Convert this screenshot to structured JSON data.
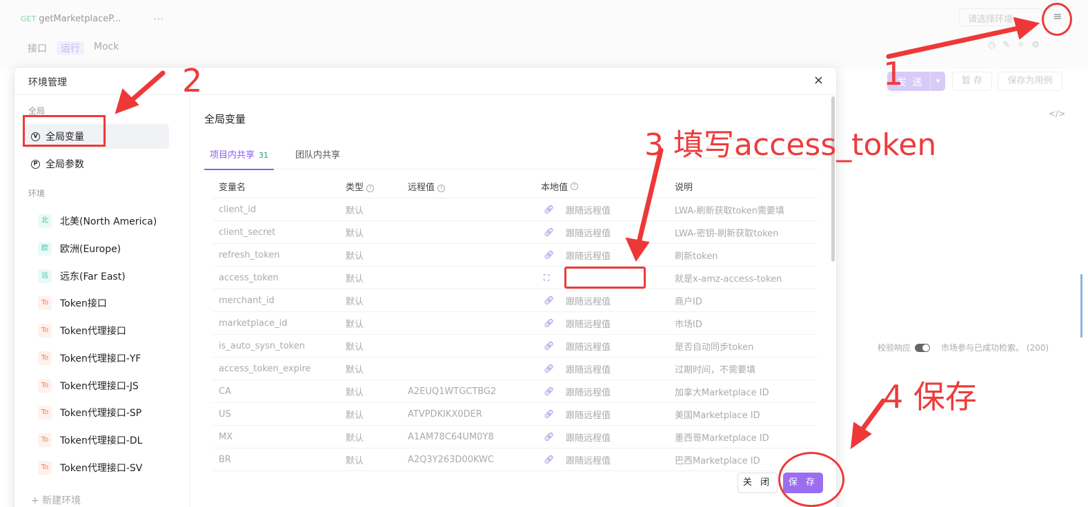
{
  "app": {
    "request_tab": {
      "method": "GET",
      "name": "getMarketplaceP..."
    },
    "more_dots": "···",
    "sub_tabs": [
      "接口",
      "运行",
      "Mock"
    ],
    "env_select": "请选择环境",
    "menu_icon": "≡",
    "send_label": "发 送",
    "save_tmp_label": "暂 存",
    "save_case_label": "保存为用例",
    "code_icon": "</>",
    "verify_label": "校验响应",
    "verify_msg": "市场参与已成功检索。 (200)"
  },
  "modal": {
    "title": "环境管理",
    "close_icon": "×",
    "sidebar": {
      "global_section": "全局",
      "global_items": [
        {
          "icon": "V",
          "label": "全局变量"
        },
        {
          "icon": "P",
          "label": "全局参数"
        }
      ],
      "env_section": "环境",
      "environments": [
        {
          "badge": "北",
          "label": "北美(North America)",
          "color": "teal"
        },
        {
          "badge": "欧",
          "label": "欧洲(Europe)",
          "color": "teal"
        },
        {
          "badge": "远",
          "label": "远东(Far East)",
          "color": "teal"
        },
        {
          "badge": "To",
          "label": "Token接口",
          "color": "orange"
        },
        {
          "badge": "To",
          "label": "Token代理接口",
          "color": "orange"
        },
        {
          "badge": "To",
          "label": "Token代理接口-YF",
          "color": "orange"
        },
        {
          "badge": "To",
          "label": "Token代理接口-JS",
          "color": "orange"
        },
        {
          "badge": "To",
          "label": "Token代理接口-SP",
          "color": "orange"
        },
        {
          "badge": "To",
          "label": "Token代理接口-DL",
          "color": "orange"
        },
        {
          "badge": "To",
          "label": "Token代理接口-SV",
          "color": "orange"
        }
      ],
      "new_env": "+ 新建环境"
    },
    "content": {
      "title": "全局变量",
      "tabs": [
        {
          "label": "项目内共享",
          "count": "31"
        },
        {
          "label": "团队内共享"
        }
      ],
      "headers": [
        "变量名",
        "类型",
        "远程值",
        "本地值",
        "说明"
      ],
      "rows": [
        {
          "name": "client_id",
          "type": "默认",
          "remote": "",
          "local": "跟随远程值",
          "desc": "LWA-刷新获取token需要填"
        },
        {
          "name": "client_secret",
          "type": "默认",
          "remote": "",
          "local": "跟随远程值",
          "desc": "LWA-密钥-刷新获取token"
        },
        {
          "name": "refresh_token",
          "type": "默认",
          "remote": "",
          "local": "跟随远程值",
          "desc": "刷新token"
        },
        {
          "name": "access_token",
          "type": "默认",
          "remote": "",
          "local": "",
          "desc": "就是x-amz-access-token"
        },
        {
          "name": "merchant_id",
          "type": "默认",
          "remote": "",
          "local": "跟随远程值",
          "desc": "商户ID"
        },
        {
          "name": "marketplace_id",
          "type": "默认",
          "remote": "",
          "local": "跟随远程值",
          "desc": "市场ID"
        },
        {
          "name": "is_auto_sysn_token",
          "type": "默认",
          "remote": "",
          "local": "跟随远程值",
          "desc": "是否自动同步token"
        },
        {
          "name": "access_token_expire",
          "type": "默认",
          "remote": "",
          "local": "跟随远程值",
          "desc": "过期时间，不需要填"
        },
        {
          "name": "CA",
          "type": "默认",
          "remote": "A2EUQ1WTGCTBG2",
          "local": "跟随远程值",
          "desc": "加拿大Marketplace ID"
        },
        {
          "name": "US",
          "type": "默认",
          "remote": "ATVPDKIKX0DER",
          "local": "跟随远程值",
          "desc": "美国Marketplace ID"
        },
        {
          "name": "MX",
          "type": "默认",
          "remote": "A1AM78C64UM0Y8",
          "local": "跟随远程值",
          "desc": "墨西哥Marketplace ID"
        },
        {
          "name": "BR",
          "type": "默认",
          "remote": "A2Q3Y263D00KWC",
          "local": "跟随远程值",
          "desc": "巴西Marketplace ID"
        }
      ],
      "close_label": "关 闭",
      "save_label": "保 存"
    }
  },
  "annotations": {
    "step1": "1",
    "step2": "2",
    "step3": "3 填写access_token",
    "step4": "4 保存"
  },
  "colors": {
    "accent": "#8b5cf6",
    "annotation": "#ee3838"
  }
}
